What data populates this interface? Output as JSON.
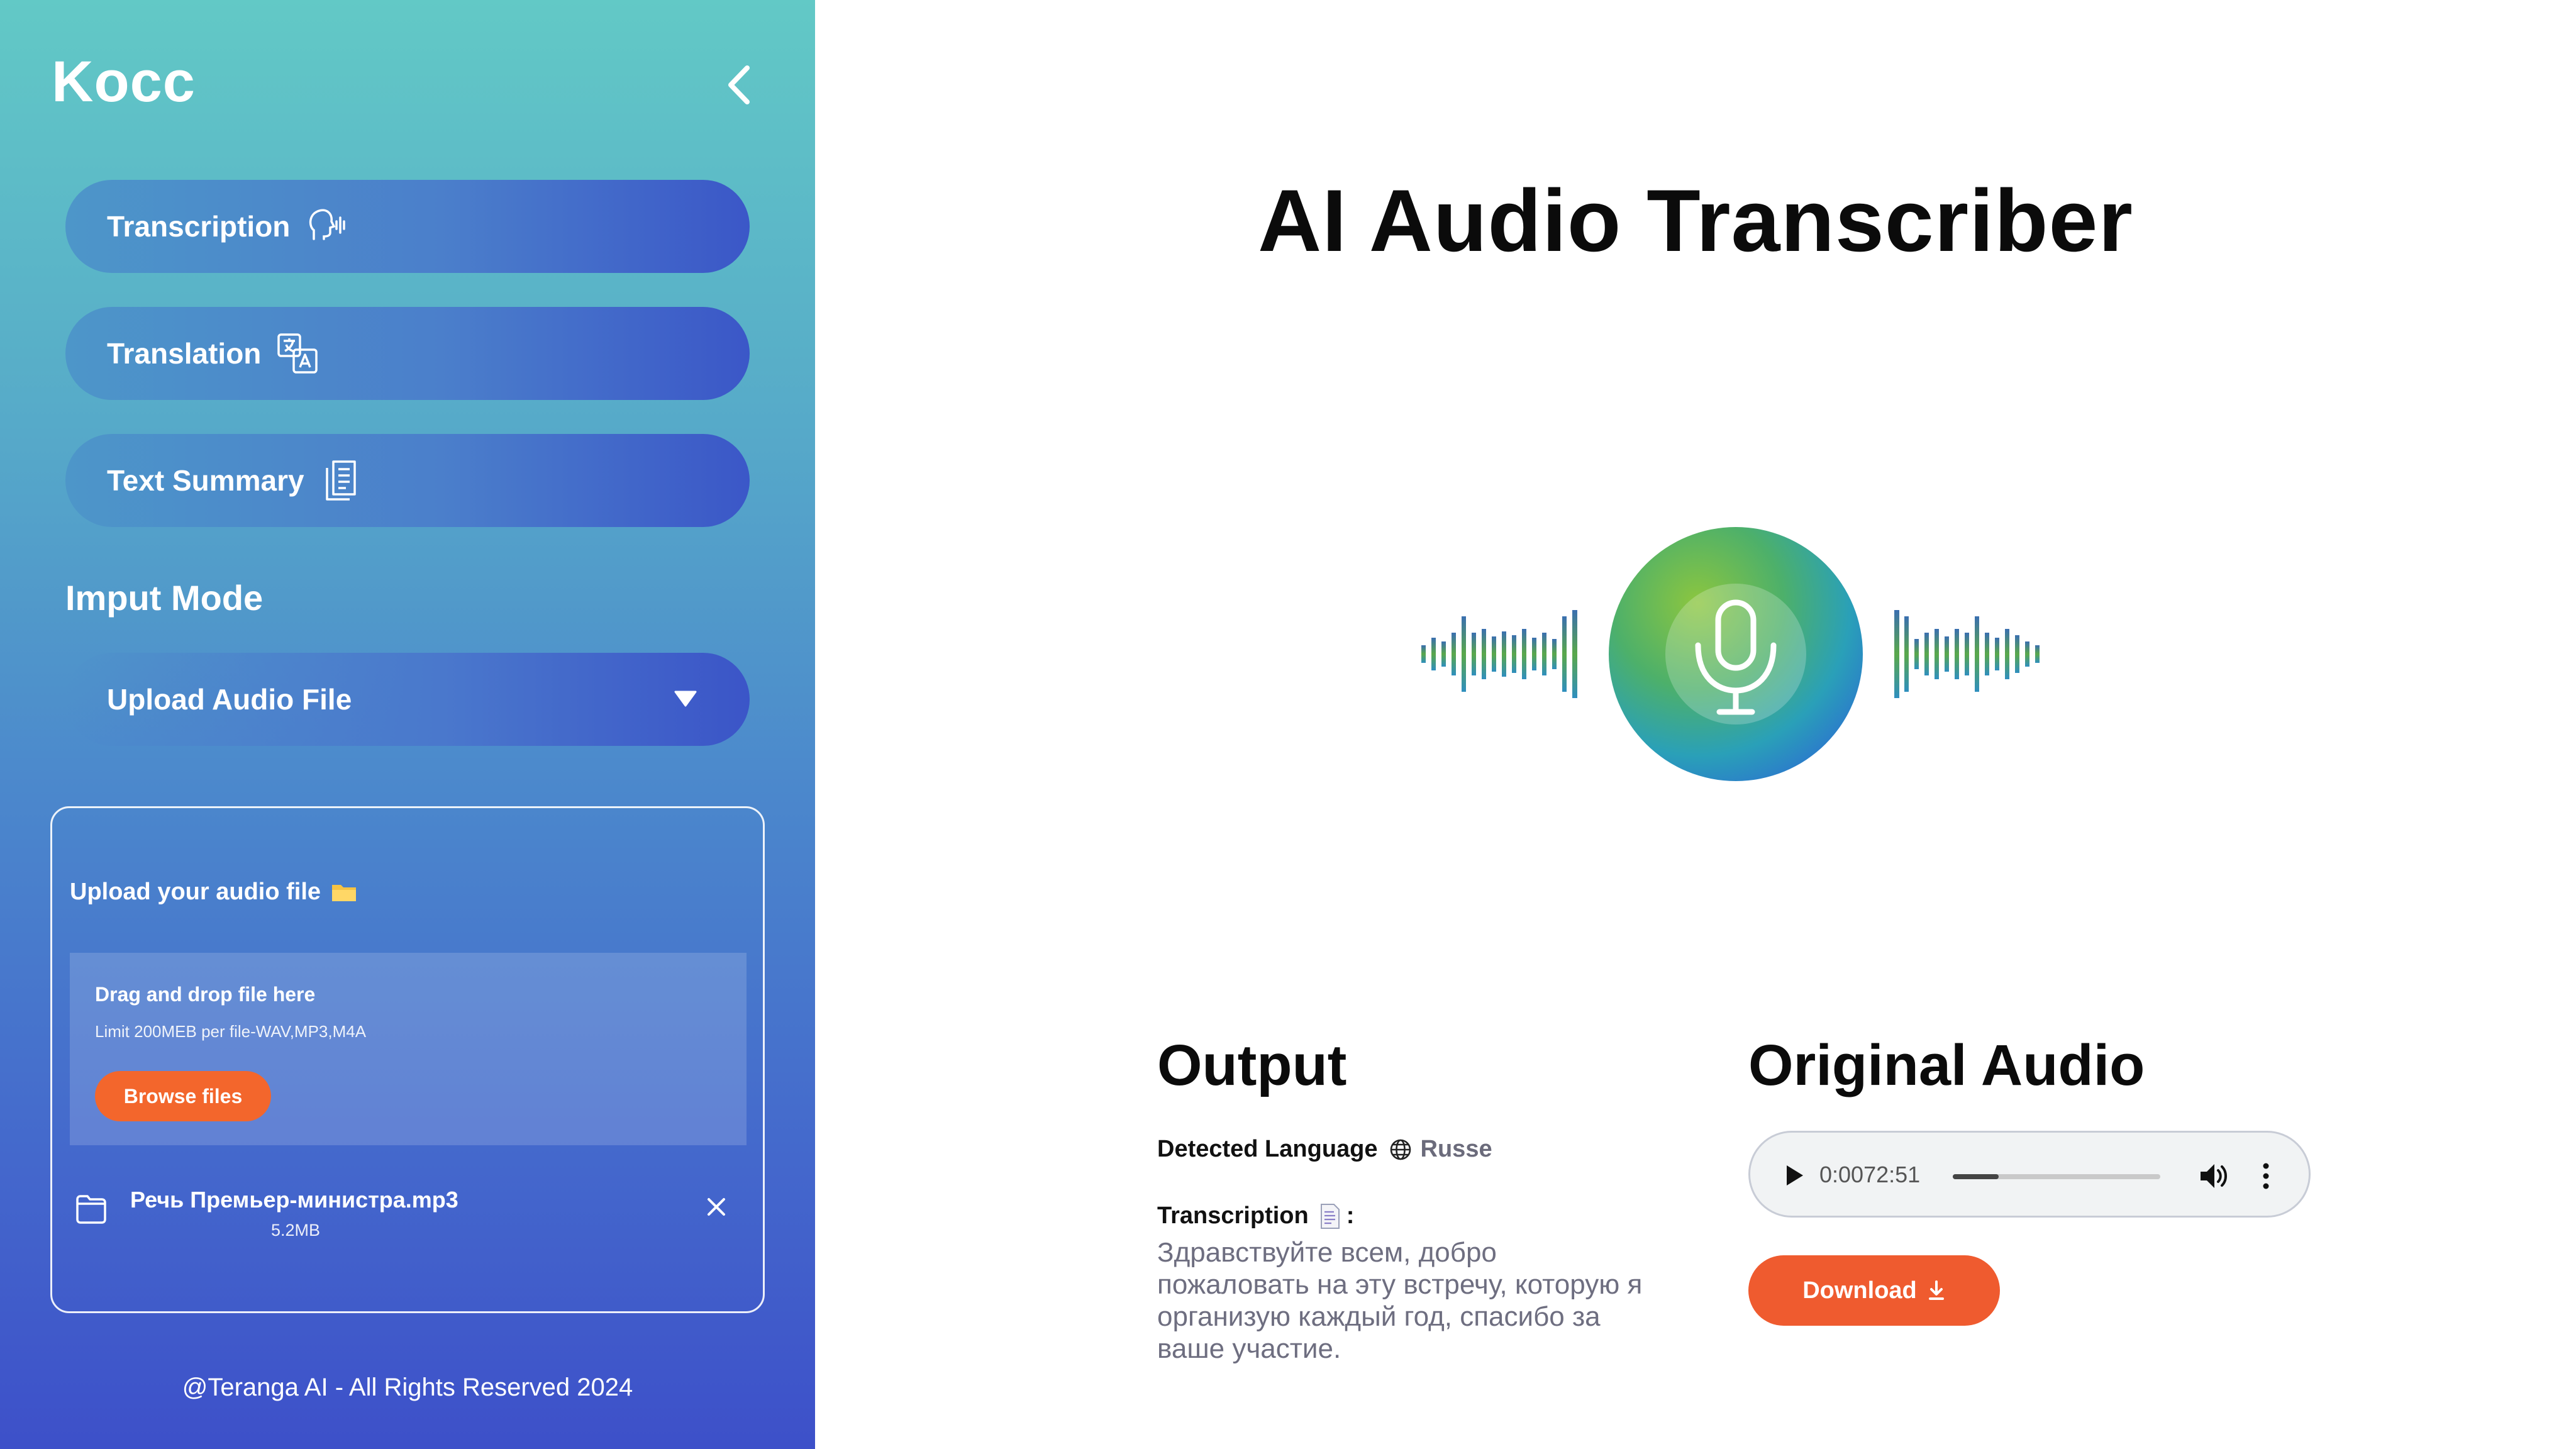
{
  "sidebar": {
    "brand": "Kocc",
    "nav": [
      {
        "label": "Transcription",
        "icon": "voice-recognition-icon"
      },
      {
        "label": "Translation",
        "icon": "translate-icon"
      },
      {
        "label": "Text Summary",
        "icon": "documents-icon"
      }
    ],
    "mode_label": "Imput Mode",
    "mode_select": {
      "value": "Upload Audio File"
    },
    "upload": {
      "title": "Upload your audio file",
      "dropzone_title": "Drag and drop file here",
      "dropzone_limit": "Limit 200MEB per file-WAV,MP3,M4A",
      "browse_label": "Browse files",
      "file": {
        "name": "Речь Премьер-министра.mp3",
        "size": "5.2MB"
      }
    },
    "footer": "@Teranga AI - All Rights Reserved 2024"
  },
  "main": {
    "title": "AI Audio Transcriber",
    "output": {
      "title": "Output",
      "detected_language_label": "Detected Language",
      "detected_language_value": "Russe",
      "transcription_label": "Transcription",
      "transcription_suffix": ":",
      "transcription_text": "Здравствуйте всем, добро пожаловать на эту встречу, которую я организую каждый год, спасибо за ваше участие."
    },
    "original_audio": {
      "title": "Original Audio",
      "player_time": "0:0072:51",
      "progress": 0.22,
      "download_label": "Download"
    }
  },
  "colors": {
    "sidebar_top": "#62c9c6",
    "sidebar_bottom": "#3d50c9",
    "accent_orange": "#f3662c",
    "download_orange": "#ef5b2f"
  }
}
